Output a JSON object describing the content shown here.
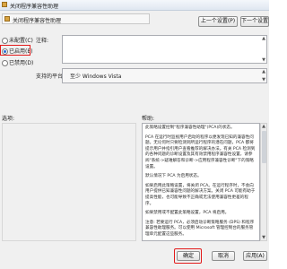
{
  "window": {
    "title": "关闭程序兼容性助理"
  },
  "header": {
    "setting_label": "关闭程序兼容性助理",
    "prev_button": "上一个设置(P)",
    "next_button": "下一个设置(N)"
  },
  "state": {
    "options": [
      {
        "label": "未配置(C)",
        "selected": false
      },
      {
        "label": "已启用(E)",
        "selected": true
      },
      {
        "label": "已禁用(D)",
        "selected": false
      }
    ]
  },
  "comment": {
    "label": "注释:",
    "value": ""
  },
  "supported": {
    "label": "支持的平台:",
    "value": "至少 Windows Vista"
  },
  "panels": {
    "options_label": "选项:",
    "help_label": "帮助:"
  },
  "help": {
    "paragraphs": [
      "此策略设置控制\"程序兼容性助理\"(PCA)的状态。",
      "PCA 在运行时监视用户启动的程序以便发现已知的兼容性问题。无论何时只要检测到所运行程序的潜在问题，PCA 都将提示用户并指引用户查看推荐的解决办法。有关 PCA 检测到的各种问题的诊断设置及其有效禁用程序兼容性设置，请参阅\"系统->疑难解答和诊断->应用程序兼容性诊断\"下的策略设置。",
      "默认情况下 PCA 为启用状态。",
      "如果启用此策略设置，将关闭 PCA。在运行程序时，不会向用户提供已知兼容性问题的解决方案。关闭 PCA 可能有助于提高性能，也可能导致不正确或无法使用兼容性更差的程序。",
      "如果禁用或不配置此策略设置，PCA 将启用。",
      "注意: 若要运行 PCA，必须启动诊断策略服务 (DPS) 和程序兼容性助理服务。可以使用 Microsoft 管理控制台的服务管理单元配置这些服务。"
    ]
  },
  "footer": {
    "ok_button": "确定",
    "cancel_button": "取消",
    "apply_button": "应用(A)"
  },
  "colors": {
    "highlight": "#e21b1b",
    "dialog_bg": "#f0f0f0"
  }
}
